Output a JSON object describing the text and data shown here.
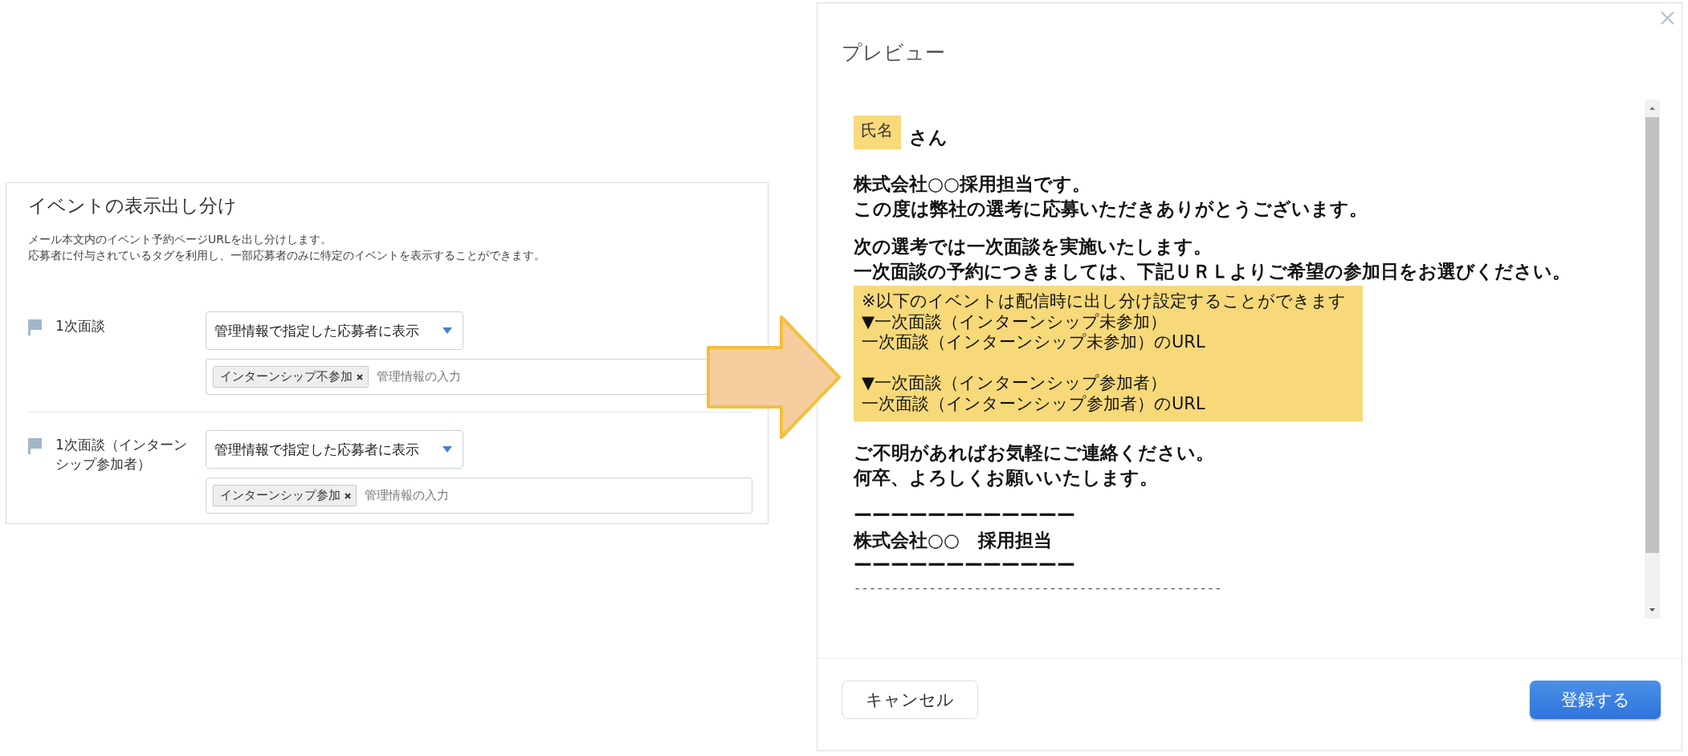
{
  "event_display_settings": {
    "title": "イベントの表示出し分け",
    "description": [
      "メール本文内のイベント予約ページURLを出し分けします。",
      "応募者に付与されているタグを利用し、一部応募者のみに特定のイベントを表示することができます。"
    ],
    "events": [
      {
        "name": "1次面談",
        "display_condition": "管理情報で指定した応募者に表示",
        "tags": [
          {
            "label": "インターンシップ不参加"
          }
        ],
        "placeholder": "管理情報の入力"
      },
      {
        "name": "1次面談（インターンシップ参加者）",
        "display_condition": "管理情報で指定した応募者に表示",
        "tags": [
          {
            "label": "インターンシップ参加"
          }
        ],
        "placeholder": "管理情報の入力"
      }
    ]
  },
  "preview_dialog": {
    "title": "プレビュー",
    "body": [
      {
        "kind": "name_line",
        "tag": "氏名",
        "text": "さん"
      },
      {
        "kind": "paragraph",
        "lines": [
          "株式会社○○採用担当です。",
          "この度は弊社の選考に応募いただきありがとうございます。"
        ]
      },
      {
        "kind": "paragraph",
        "lines": [
          "次の選考では一次面談を実施いたします。",
          "一次面談の予約につきましては、下記ＵＲＬよりご希望の参加日をお選びください。"
        ]
      },
      {
        "kind": "highlight",
        "groups": [
          [
            "※以下のイベントは配信時に出し分け設定することができます",
            "▼一次面談（インターンシップ未参加）",
            "一次面談（インターンシップ未参加）のURL"
          ],
          [
            "▼一次面談（インターンシップ参加者）",
            "一次面談（インターンシップ参加者）のURL"
          ]
        ]
      },
      {
        "kind": "paragraph",
        "lines": [
          "ご不明があればお気軽にご連絡ください。",
          "何卒、よろしくお願いいたします。"
        ]
      },
      {
        "kind": "paragraph",
        "lines": [
          "ーーーーーーーーーーーー",
          "株式会社○○　採用担当",
          "ーーーーーーーーーーーー"
        ]
      },
      {
        "kind": "separator",
        "text": "-------------------------------------------------"
      }
    ],
    "buttons": [
      {
        "label": "キャンセル",
        "kind": "secondary"
      },
      {
        "label": "登録する",
        "kind": "primary"
      }
    ]
  }
}
